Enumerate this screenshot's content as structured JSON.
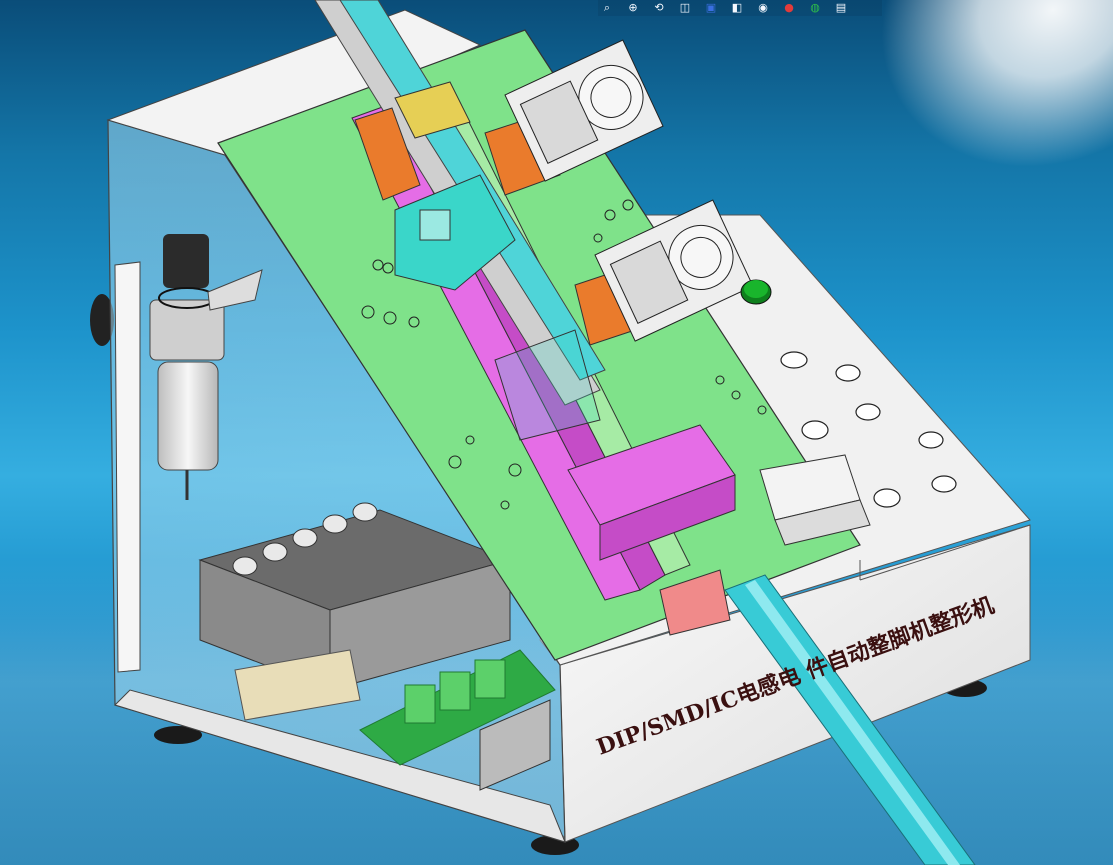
{
  "app": {
    "toolbar": {
      "icons": [
        {
          "name": "zoom-to-fit-icon",
          "glyph": "⌕"
        },
        {
          "name": "zoom-area-icon",
          "glyph": "⊕"
        },
        {
          "name": "previous-view-icon",
          "glyph": "⟲"
        },
        {
          "name": "section-view-icon",
          "glyph": "◫"
        },
        {
          "name": "view-orientation-icon",
          "glyph": "▣"
        },
        {
          "name": "display-style-icon",
          "glyph": "◧"
        },
        {
          "name": "hide-show-items-icon",
          "glyph": "◉"
        },
        {
          "name": "edit-appearance-icon",
          "glyph": "●"
        },
        {
          "name": "apply-scene-icon",
          "glyph": "◍"
        },
        {
          "name": "view-settings-icon",
          "glyph": "▤"
        }
      ],
      "colors": {
        "appearance_red": "#e23b3b",
        "appearance_green": "#2fbf4a",
        "appearance_blue": "#3a6fe0"
      }
    }
  },
  "model": {
    "machine_label": "DIP/SMD/IC电感电    件自动整脚机整形机",
    "colors": {
      "main_plate": "#7fe28a",
      "housing": "#f4f4f4",
      "cylinder": "#ececec",
      "bracket_cyan": "#3ad6c9",
      "rail_pink": "#e56de6",
      "block_orange": "#ea7b2c",
      "block_yellow": "#e6cf55",
      "feed_rail": "#38cbd6",
      "start_button": "#19b52c",
      "pcb_green": "#40c45b",
      "background": "#1d93cb"
    }
  }
}
